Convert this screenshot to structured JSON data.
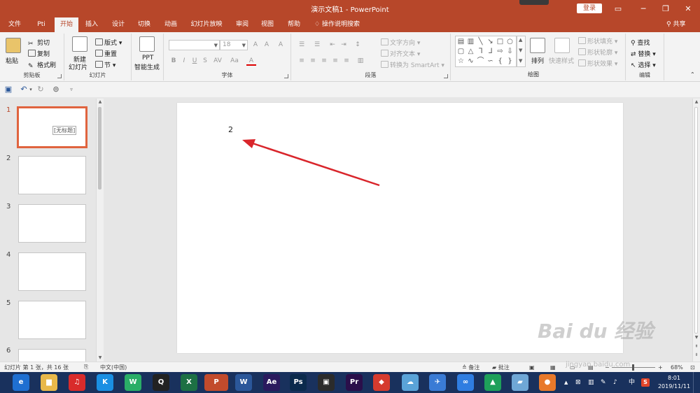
{
  "titlebar": {
    "title": "演示文稿1 - PowerPoint",
    "login": "登录",
    "restore_ribbon_icon": "ribbon-display-icon",
    "minimize": "─",
    "maximize": "❐",
    "close": "✕"
  },
  "tabs": [
    {
      "label": "文件"
    },
    {
      "label": "Pti"
    },
    {
      "label": "开始"
    },
    {
      "label": "插入"
    },
    {
      "label": "设计"
    },
    {
      "label": "切换"
    },
    {
      "label": "动画"
    },
    {
      "label": "幻灯片放映"
    },
    {
      "label": "审阅"
    },
    {
      "label": "视图"
    },
    {
      "label": "帮助"
    }
  ],
  "tell_me": "操作说明搜索",
  "share": "共享",
  "ribbon": {
    "clipboard": {
      "paste": "粘贴",
      "cut": "剪切",
      "copy": "复制",
      "format_painter": "格式刷",
      "label": "剪贴板"
    },
    "slides": {
      "new_slide_1": "新建",
      "new_slide_2": "幻灯片",
      "layout": "版式",
      "reset": "重置",
      "section": "节",
      "label": "幻灯片"
    },
    "ppt": {
      "line1": "PPT",
      "line2": "智能生成"
    },
    "font": {
      "name_value": "",
      "size_value": "18",
      "label": "字体",
      "grow": "A",
      "shrink": "A",
      "clear": "A",
      "bold": "B",
      "italic": "I",
      "underline": "U",
      "strike": "S",
      "spacing": "AV",
      "case": "Aa",
      "color": "A"
    },
    "paragraph": {
      "text_direction": "文字方向",
      "align_text": "对齐文本",
      "smartart": "转换为 SmartArt",
      "label": "段落"
    },
    "drawing": {
      "arrange": "排列",
      "quick_styles": "快速样式",
      "fill": "形状填充",
      "outline": "形状轮廓",
      "effects": "形状效果",
      "label": "绘图"
    },
    "editing": {
      "find": "查找",
      "replace": "替换",
      "select": "选择",
      "label": "编辑"
    }
  },
  "thumbnails": [
    {
      "num": "1",
      "text": "[无标题]"
    },
    {
      "num": "2",
      "text": ""
    },
    {
      "num": "3",
      "text": ""
    },
    {
      "num": "4",
      "text": ""
    },
    {
      "num": "5",
      "text": ""
    },
    {
      "num": "6",
      "text": ""
    }
  ],
  "slide": {
    "text": "2"
  },
  "status": {
    "slide_info": "幻灯片 第 1 张，共 16 张",
    "language": "中文(中国)",
    "notes": "备注",
    "comments": "批注",
    "zoom": "68%",
    "zoom_out": "−",
    "zoom_in": "+"
  },
  "taskbar": {
    "apps": [
      {
        "name": "browser",
        "label": "e",
        "color": "#1f6fd1"
      },
      {
        "name": "explorer",
        "label": "▆",
        "color": "#e8b84a"
      },
      {
        "name": "netease-music",
        "label": "♫",
        "color": "#d92b2b"
      },
      {
        "name": "kugou",
        "label": "K",
        "color": "#1a8fe3"
      },
      {
        "name": "wechat",
        "label": "W",
        "color": "#2aae67"
      },
      {
        "name": "qq",
        "label": "Q",
        "color": "#222222"
      },
      {
        "name": "excel",
        "label": "X",
        "color": "#1d7044"
      },
      {
        "name": "powerpoint",
        "label": "P",
        "color": "#c24b2c"
      },
      {
        "name": "word",
        "label": "W",
        "color": "#2b579a"
      },
      {
        "name": "after-effects",
        "label": "Ae",
        "color": "#2a1a5e"
      },
      {
        "name": "photoshop",
        "label": "Ps",
        "color": "#0b2a4c"
      },
      {
        "name": "video-editor",
        "label": "▣",
        "color": "#2b2b2b"
      },
      {
        "name": "premiere",
        "label": "Pr",
        "color": "#2a0f4a"
      },
      {
        "name": "wps",
        "label": "◆",
        "color": "#d63b2e"
      },
      {
        "name": "cloud-app",
        "label": "☁",
        "color": "#5aa3d8"
      },
      {
        "name": "feishu",
        "label": "✈",
        "color": "#3a7bd5"
      },
      {
        "name": "baidu-netdisk",
        "label": "∞",
        "color": "#2f7de1"
      },
      {
        "name": "green-app",
        "label": "▲",
        "color": "#1ea05a"
      },
      {
        "name": "notes-app",
        "label": "▰",
        "color": "#6fa7d6"
      },
      {
        "name": "orange-app",
        "label": "●",
        "color": "#e8792a"
      }
    ],
    "tray": {
      "up": "▲",
      "ime": "中",
      "sogou": "S"
    },
    "time": "8:01",
    "date": "2019/11/11"
  },
  "watermark": {
    "text": "Bai du 经验",
    "url": "jingyan.baidu.com"
  },
  "colors": {
    "accent": "#b7472a",
    "thumb_active": "#e0643f",
    "arrow": "#d9252b"
  }
}
